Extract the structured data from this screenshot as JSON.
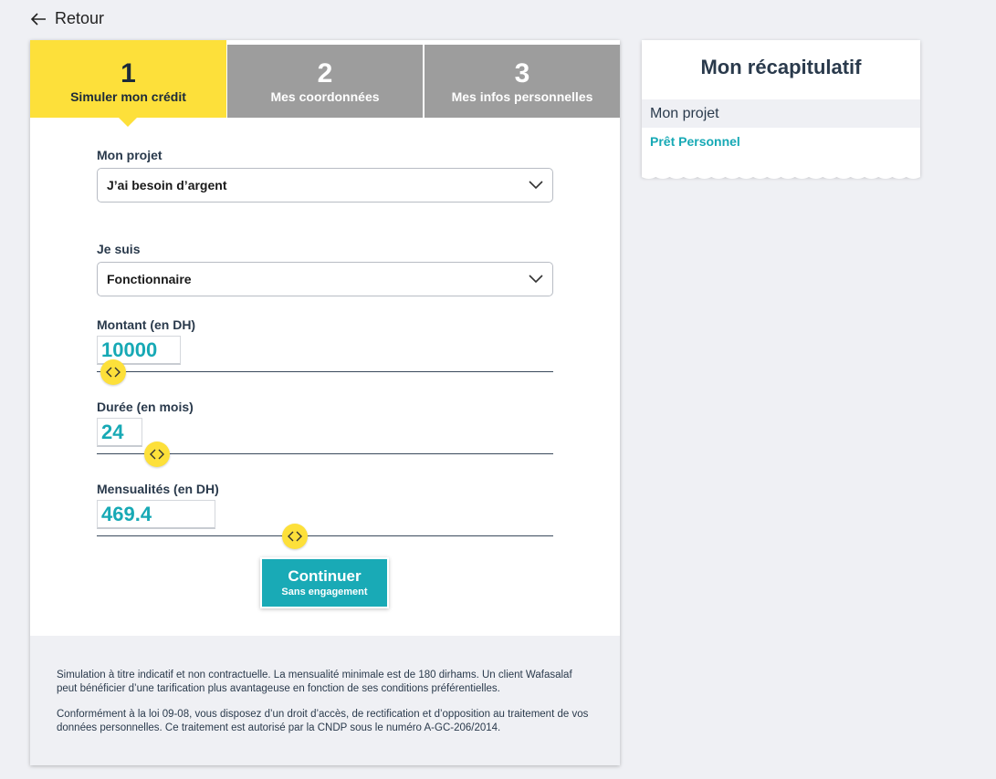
{
  "back": {
    "label": "Retour"
  },
  "steps": [
    {
      "num": "1",
      "label": "Simuler mon crédit"
    },
    {
      "num": "2",
      "label": "Mes coordonnées"
    },
    {
      "num": "3",
      "label": "Mes infos personnelles"
    }
  ],
  "form": {
    "projet": {
      "label": "Mon projet",
      "value": "J’ai besoin d’argent"
    },
    "profil": {
      "label": "Je suis",
      "value": "Fonctionnaire"
    },
    "montant": {
      "label": "Montant (en DH)",
      "value": "10000"
    },
    "duree": {
      "label": "Durée (en mois)",
      "value": "24"
    },
    "mensualites": {
      "label": "Mensualités (en DH)",
      "value": "469.4"
    }
  },
  "button": {
    "title": "Continuer",
    "subtitle": "Sans engagement"
  },
  "footer": {
    "p1": "Simulation à titre indicatif et non contractuelle. La mensualité minimale est de 180 dirhams. Un client Wafasalaf peut bénéficier d’une tarification plus avantageuse en fonction de ses conditions préférentielles.",
    "p2": "Conformément à la loi 09-08, vous disposez d’un droit d’accès, de rectification et d’opposition au traitement de vos données personnelles. Ce traitement est autorisé par la CNDP sous le numéro A-GC-206/2014."
  },
  "recap": {
    "title": "Mon récapitulatif",
    "section": "Mon projet",
    "item": "Prêt Personnel"
  },
  "colors": {
    "yellow": "#fde03a",
    "teal": "#19aab6",
    "grey": "#9d9d9d"
  }
}
